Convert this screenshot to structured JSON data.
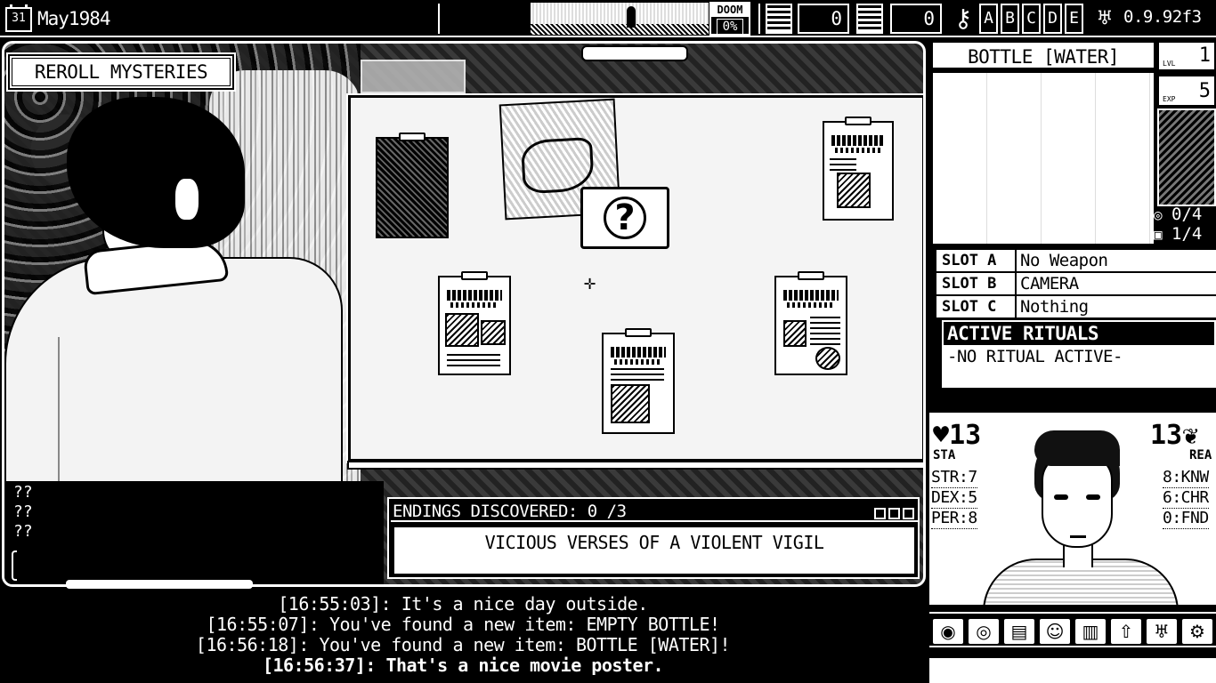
{
  "topbar": {
    "calendar_day": "31",
    "date": "May1984",
    "doom_label": "DOOM",
    "doom_value": "0%",
    "counter1_value": "0",
    "counter2_value": "0",
    "letters": [
      "A",
      "B",
      "C",
      "D",
      "E"
    ],
    "version": "0.9.92f3",
    "icons": {
      "calendar": "calendar-icon",
      "counter1": "film-icon",
      "counter2": "ammo-icon",
      "key": "key-icon",
      "octopus": "octopus-icon"
    }
  },
  "stage": {
    "reroll_label": "REROLL MYSTERIES",
    "question_lines": [
      "??",
      "??",
      "??"
    ],
    "question_mark": "?"
  },
  "endings": {
    "label": "ENDINGS DISCOVERED: 0 /3",
    "mystery_title": "VICIOUS VERSES OF A VIOLENT VIGIL"
  },
  "log": {
    "lines": [
      {
        "time": "[16:55:03]",
        "text": "It's a nice day outside."
      },
      {
        "time": "[16:55:07]",
        "text": "You've found a new item: EMPTY BOTTLE!"
      },
      {
        "time": "[16:56:18]",
        "text": "You've found a new item: BOTTLE [WATER]!"
      },
      {
        "time": "[16:56:37]",
        "text": "That's a nice movie poster."
      }
    ]
  },
  "right_panel": {
    "item_title": "BOTTLE [WATER]",
    "lvl_label": "LVL",
    "lvl_value": "1",
    "exp_label": "EXP",
    "exp_value": "5",
    "spiral_count": "0/4",
    "bag_count": "1/4",
    "slots": [
      {
        "key": "SLOT A",
        "value": "No Weapon"
      },
      {
        "key": "SLOT B",
        "value": "CAMERA"
      },
      {
        "key": "SLOT C",
        "value": "Nothing"
      }
    ],
    "rituals_title": "ACTIVE RITUALS",
    "rituals_body": "-NO RITUAL ACTIVE-",
    "sta_value": "13",
    "sta_label": "STA",
    "rea_value": "13",
    "rea_label": "REA",
    "left_stats": [
      "STR:7",
      "DEX:5",
      "PER:8"
    ],
    "right_stats": [
      "8:KNW",
      "6:CHR",
      "0:FND"
    ],
    "toolbar_icons": [
      "mystery-icon",
      "spiral-icon",
      "stats-icon",
      "contacts-icon",
      "city-icon",
      "upgrade-icon",
      "octopus-icon",
      "settings-icon"
    ]
  }
}
